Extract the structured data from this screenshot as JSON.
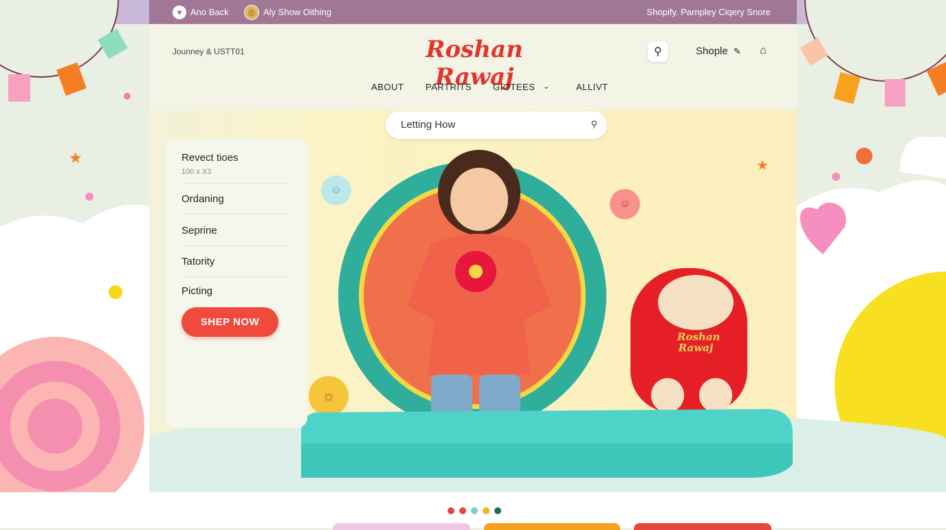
{
  "topbar": {
    "left_items": [
      {
        "icon": "heart-person-icon",
        "label": "Ano Back"
      },
      {
        "icon": "coin-icon",
        "label": "Aly Show Oithing"
      }
    ],
    "right_text": "Shopify. Parnpley Ciqery Snore"
  },
  "header": {
    "tagline": "Jounney & USTT01",
    "logo": "Roshan Rawaj",
    "account_label": "Shople"
  },
  "nav": {
    "items": [
      "ABOUT",
      "PARTRITS",
      "GIOTEES",
      "ALLIVT"
    ],
    "dropdown_on": "GIOTEES"
  },
  "hero_search": {
    "value": "Letting How",
    "icon": "search-icon"
  },
  "card": {
    "title": "Revect tioes",
    "subtitle": "100 x X3",
    "items": [
      "Ordaning",
      "Seprine",
      "Tatority",
      "Picting"
    ],
    "cta": "SHEP NOW"
  },
  "mascot": {
    "shirt_text_line1": "Roshan",
    "shirt_text_line2": "Rawaj"
  },
  "carousel": {
    "dots": [
      "#e8453c",
      "#e8453c",
      "#79d0c7",
      "#f2b41c",
      "#1c6b6b"
    ]
  },
  "colors": {
    "accent": "#f04a3c",
    "topbar": "#a17796",
    "logo": "#e2362c"
  }
}
